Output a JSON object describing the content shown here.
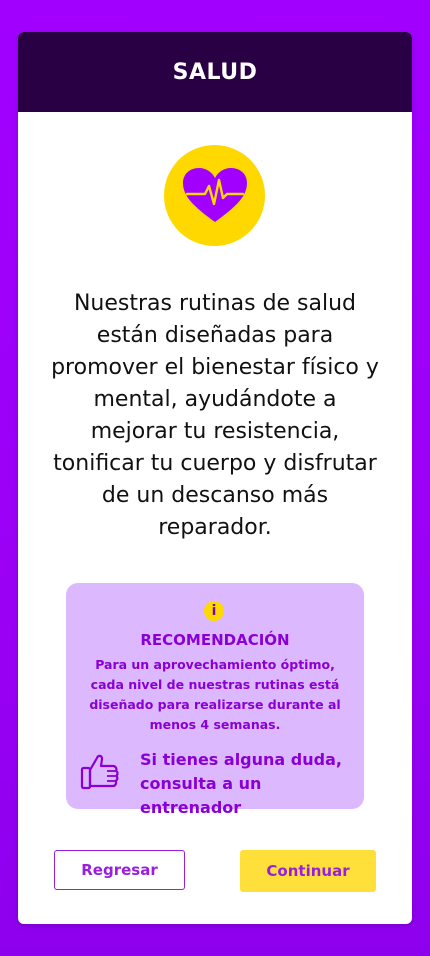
{
  "header": {
    "title": "SALUD"
  },
  "hero_icon": {
    "name": "heart-pulse-icon",
    "bg_color": "#ffd800",
    "fg_color": "#a100ff"
  },
  "description": "Nuestras rutinas de salud están diseñadas para promover el bienestar físico y mental, ayudándote a mejorar tu resistencia, tonificar tu cuerpo y disfrutar de un descanso más reparador.",
  "recommendation": {
    "info_icon": "i",
    "title": "RECOMENDACIÓN",
    "text": "Para un aprovechamiento óptimo, cada nivel de nuestras rutinas está diseñado para realizarse durante al menos 4 semanas.",
    "cta_icon": "thumbs-up-icon",
    "cta_text": "Si tienes alguna duda, consulta a un entrenador"
  },
  "buttons": {
    "back_label": "Regresar",
    "next_label": "Continuar"
  },
  "colors": {
    "background": "#a100ff",
    "header_bg": "#2a0044",
    "accent_yellow": "#ffe03a",
    "accent_purple": "#9a1fdc",
    "recommendation_bg": "#dcb8ff"
  }
}
